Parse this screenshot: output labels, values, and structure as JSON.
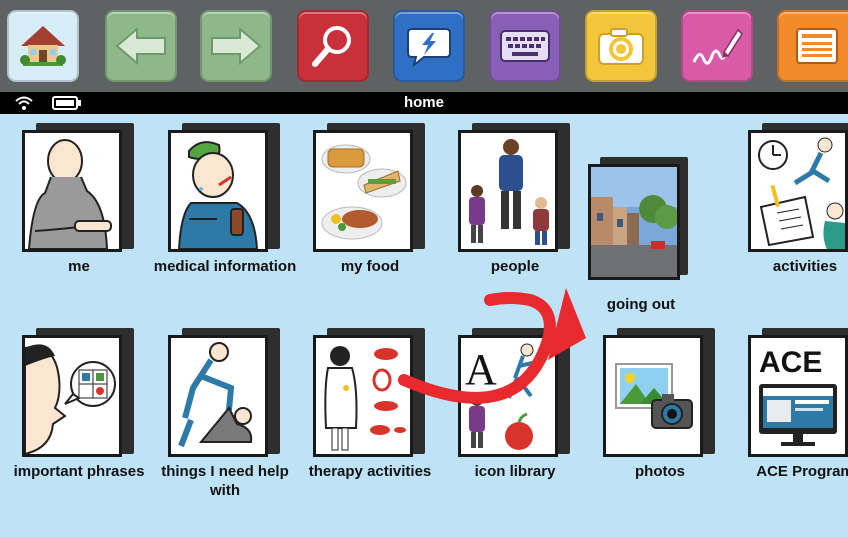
{
  "toolbar": {
    "buttons": [
      {
        "name": "home-button",
        "icon": "house-icon",
        "color": "#d6ecf7"
      },
      {
        "name": "back-button",
        "icon": "arrow-left-icon",
        "color": "#8fb88a"
      },
      {
        "name": "forward-button",
        "icon": "arrow-right-icon",
        "color": "#8fb88a"
      },
      {
        "name": "search-button",
        "icon": "magnifier-icon",
        "color": "#c8313a"
      },
      {
        "name": "chat-button",
        "icon": "speech-bubble-icon",
        "color": "#2f6fc4"
      },
      {
        "name": "keyboard-button",
        "icon": "keyboard-icon",
        "color": "#8a5fb8"
      },
      {
        "name": "camera-button",
        "icon": "camera-icon",
        "color": "#f2c53a"
      },
      {
        "name": "draw-button",
        "icon": "pen-scribble-icon",
        "color": "#d95aa7"
      },
      {
        "name": "list-button",
        "icon": "list-icon",
        "color": "#f08a2a"
      }
    ]
  },
  "status": {
    "title": "home",
    "wifi_icon": "wifi-icon",
    "battery_icon": "battery-icon"
  },
  "tiles": [
    {
      "id": "me",
      "label": "me",
      "icon": "person-pointing-icon"
    },
    {
      "id": "medical",
      "label": "medical information",
      "icon": "sick-person-icon"
    },
    {
      "id": "food",
      "label": "my food",
      "icon": "food-plates-icon"
    },
    {
      "id": "people",
      "label": "people",
      "icon": "people-group-icon"
    },
    {
      "id": "going-out",
      "label": "going out",
      "icon": "street-photo-icon"
    },
    {
      "id": "activities",
      "label": "activities",
      "icon": "activities-icon"
    },
    {
      "id": "phrases",
      "label": "important phrases",
      "icon": "speaking-person-icon"
    },
    {
      "id": "help",
      "label": "things I need help with",
      "icon": "helping-hand-icon"
    },
    {
      "id": "therapy",
      "label": "therapy activities",
      "icon": "therapist-icon"
    },
    {
      "id": "library",
      "label": "icon library",
      "icon": "icon-library-icon"
    },
    {
      "id": "photos",
      "label": "photos",
      "icon": "photo-camera-icon"
    },
    {
      "id": "ace",
      "label": "ACE Program",
      "icon": "ace-monitor-icon",
      "badge": "ACE"
    }
  ],
  "colors": {
    "background": "#bfe3f6",
    "toolbar": "#5f6263",
    "annotation_arrow": "#e8292e"
  }
}
